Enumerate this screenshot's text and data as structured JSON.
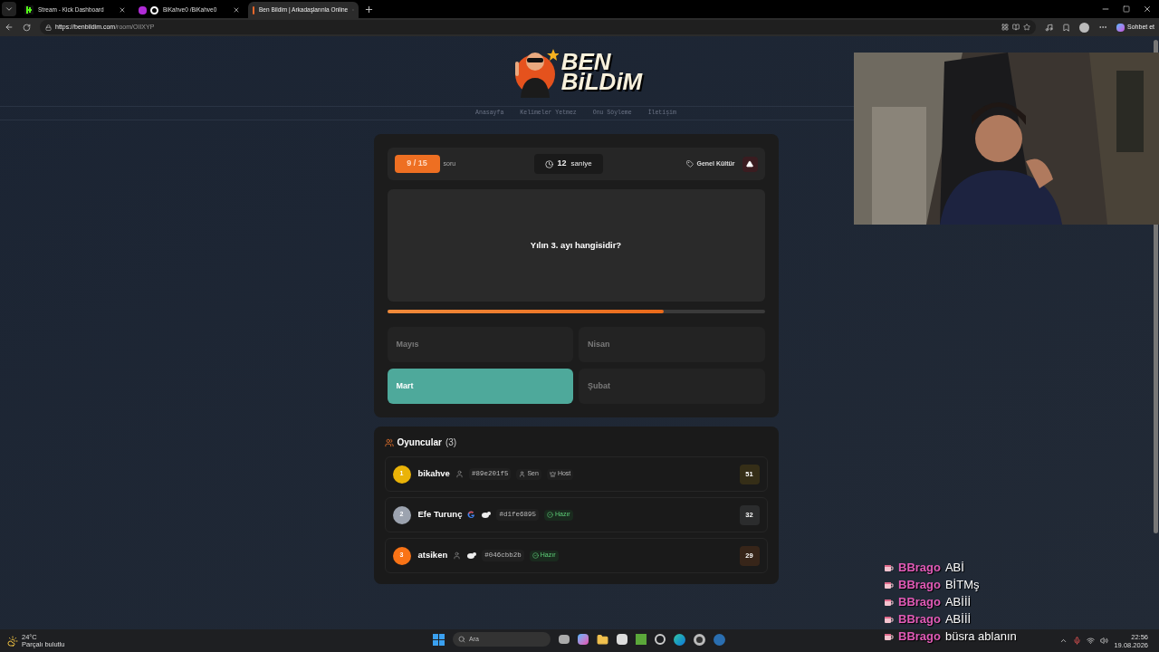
{
  "browser": {
    "tabs": [
      {
        "title": "Stream - Kick Dashboard",
        "kind": "kick",
        "selected": false
      },
      {
        "title": "BiKahve0 /BiKahve0",
        "kind": "profile",
        "selected": false
      },
      {
        "title": "Ben Bildim | Arkadaşlarınla Online",
        "kind": "site",
        "selected": true
      }
    ],
    "url_host": "https://benbildim.com",
    "url_path": "/room/OIIXYP",
    "copilot_label": "Sohbet et"
  },
  "page": {
    "logo": {
      "line1": "BEN",
      "line2": "BiLDiM"
    },
    "nav": [
      "Anasayfa",
      "Kelimeler Yetmez",
      "Onu Söyleme",
      "İletişim"
    ],
    "quiz": {
      "counter": "9 / 15",
      "counter_label": "soru",
      "timer": "12",
      "timer_unit": "saniye",
      "category": "Genel Kültür",
      "question": "Yılın 3. ayı hangisidir?",
      "progress": {
        "level": 0.733
      },
      "answers": [
        {
          "label": "Mayıs",
          "selected": false
        },
        {
          "label": "Nisan",
          "selected": false
        },
        {
          "label": "Mart",
          "selected": true
        },
        {
          "label": "Şubat",
          "selected": false
        }
      ]
    },
    "players": {
      "title": "Oyuncular",
      "count": "(3)",
      "items": [
        {
          "rank": "1",
          "color": "#eab308",
          "name": "bikahve",
          "kind": "guest",
          "avatar": false,
          "id": "#89e201f5",
          "tags": [
            {
              "kind": "you",
              "label": "Sen"
            },
            {
              "kind": "host",
              "label": "Host"
            }
          ],
          "score": "51"
        },
        {
          "rank": "2",
          "color": "#9ca3af",
          "name": "Efe Turunç",
          "kind": "google",
          "avatar": true,
          "id": "#d1fe6895",
          "tags": [
            {
              "kind": "ready",
              "label": "Hazır"
            }
          ],
          "score": "32"
        },
        {
          "rank": "3",
          "color": "#f97316",
          "name": "atsiken",
          "kind": "guest",
          "avatar": true,
          "id": "#046cbb2b",
          "tags": [
            {
              "kind": "ready",
              "label": "Hazır"
            }
          ],
          "score": "29"
        }
      ]
    }
  },
  "chat": [
    {
      "user": "BBrago",
      "message": "ABİ"
    },
    {
      "user": "BBrago",
      "message": "BİTMş"
    },
    {
      "user": "BBrago",
      "message": "ABİİİ"
    },
    {
      "user": "BBrago",
      "message": "ABİİİ"
    },
    {
      "user": "BBrago",
      "message": "büsra ablanın"
    }
  ],
  "taskbar": {
    "temperature": "24°C",
    "weather": "Parçalı bulutlu",
    "search_placeholder": "Ara",
    "time": "22:56",
    "date": "19.08.2026"
  }
}
